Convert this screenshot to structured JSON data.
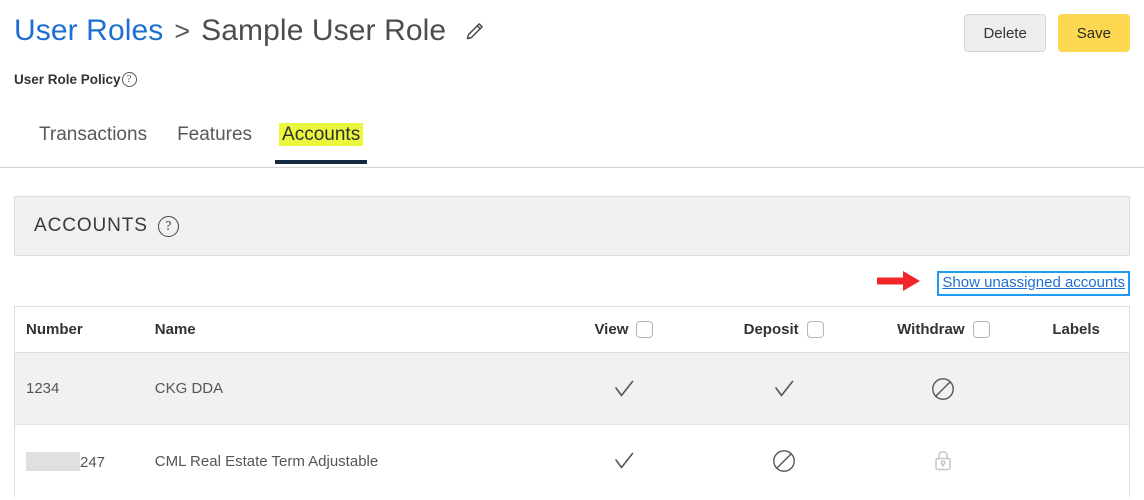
{
  "breadcrumb": {
    "parent": "User Roles",
    "separator": ">",
    "current": "Sample User Role",
    "edit_icon": "pencil-icon"
  },
  "subtitle": {
    "text": "User Role Policy",
    "help_icon": "question-circle-icon"
  },
  "actions": {
    "delete_label": "Delete",
    "save_label": "Save",
    "save_color": "#fcd850",
    "delete_color": "#eeeeee"
  },
  "tabs": [
    {
      "label": "Transactions",
      "active": false
    },
    {
      "label": "Features",
      "active": false
    },
    {
      "label": "Accounts",
      "active": true
    }
  ],
  "tab_highlight_color": "#eaf73d",
  "tab_underline_color": "#13293f",
  "panel": {
    "title": "ACCOUNTS",
    "help_icon": "question-circle-icon"
  },
  "link_row": {
    "arrow_icon": "red-right-arrow-icon",
    "arrow_color": "#f0262b",
    "link_label": "Show unassigned accounts",
    "link_color": "#1f6fd0",
    "focus_box_color": "#1e9bf0"
  },
  "table": {
    "columns": [
      {
        "key": "number",
        "label": "Number",
        "checkbox": false
      },
      {
        "key": "name",
        "label": "Name",
        "checkbox": false
      },
      {
        "key": "view",
        "label": "View",
        "checkbox": true
      },
      {
        "key": "deposit",
        "label": "Deposit",
        "checkbox": true
      },
      {
        "key": "withdraw",
        "label": "Withdraw",
        "checkbox": true
      },
      {
        "key": "labels",
        "label": "Labels",
        "checkbox": false
      }
    ],
    "rows": [
      {
        "number": "1234",
        "number_redacted": false,
        "name": "CKG DDA",
        "view": "check",
        "deposit": "check",
        "withdraw": "ban",
        "labels": ""
      },
      {
        "number": "247",
        "number_redacted": true,
        "name": "CML Real Estate Term Adjustable",
        "view": "check",
        "deposit": "ban",
        "withdraw": "lock",
        "labels": ""
      }
    ]
  }
}
